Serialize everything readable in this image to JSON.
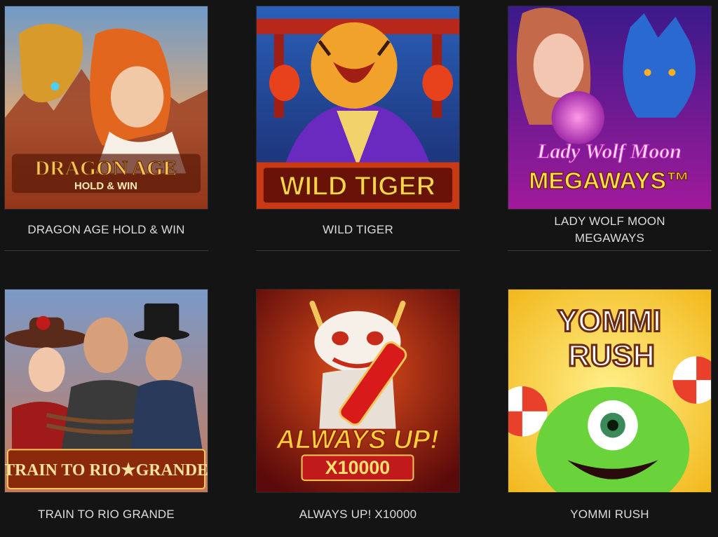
{
  "games": [
    {
      "title": "DRAGON AGE HOLD & WIN",
      "logo_line1": "DRAGON AGE",
      "logo_line2": "HOLD & WIN",
      "accent": "#c0481c"
    },
    {
      "title": "WILD TIGER",
      "logo_line1": "WILD TIGER",
      "accent": "#6a35b8"
    },
    {
      "title": "LADY WOLF MOON MEGAWAYS",
      "title_line1": "LADY WOLF MOON",
      "title_line2": "MEGAWAYS",
      "logo_line1": "Lady Wolf Moon",
      "logo_line2": "MEGAWAYS™",
      "accent": "#7a2ac0"
    },
    {
      "title": "TRAIN TO RIO GRANDE",
      "logo_line1": "TRAIN TO RIO★GRANDE",
      "accent": "#8a3a1a"
    },
    {
      "title": "ALWAYS UP! X10000",
      "logo_line1": "ALWAYS UP!",
      "logo_line2": "X10000",
      "accent": "#9e1414"
    },
    {
      "title": "YOMMI RUSH",
      "logo_line1": "YOMMI",
      "logo_line2": "RUSH",
      "accent": "#f2c21c"
    }
  ]
}
